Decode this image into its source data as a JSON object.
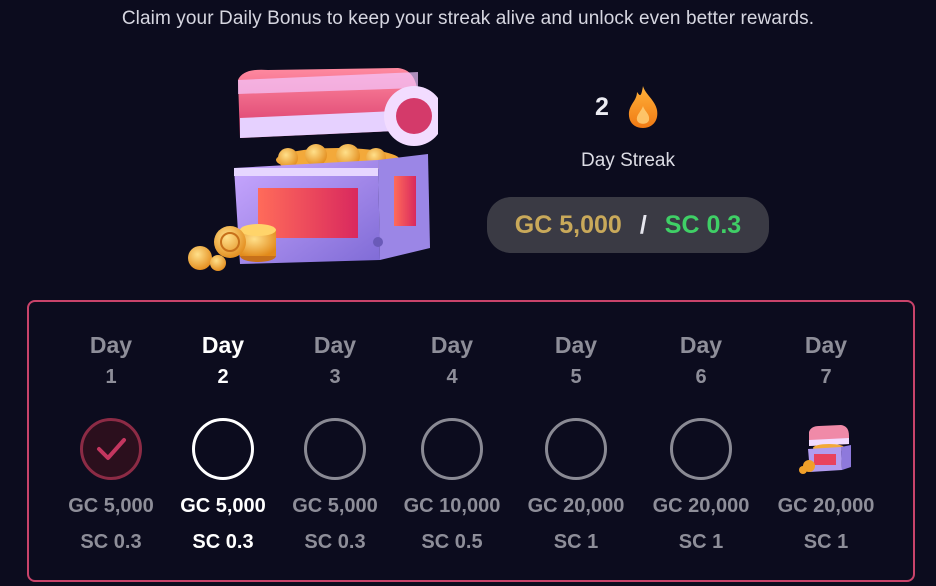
{
  "header": {
    "subtitle": "Claim your Daily Bonus to keep your streak alive and unlock even better rewards."
  },
  "hero": {
    "image": "treasure-chest-icon"
  },
  "streak": {
    "count": "2",
    "icon": "flame-icon",
    "label": "Day Streak"
  },
  "reward": {
    "gc": "GC 5,000",
    "separator": "/",
    "sc": "SC 0.3"
  },
  "days": [
    {
      "label": "Day",
      "number": "1",
      "gc": "GC 5,000",
      "sc": "SC 0.3",
      "status": "claimed"
    },
    {
      "label": "Day",
      "number": "2",
      "gc": "GC 5,000",
      "sc": "SC 0.3",
      "status": "current"
    },
    {
      "label": "Day",
      "number": "3",
      "gc": "GC 5,000",
      "sc": "SC 0.3",
      "status": "locked"
    },
    {
      "label": "Day",
      "number": "4",
      "gc": "GC 10,000",
      "sc": "SC 0.5",
      "status": "locked"
    },
    {
      "label": "Day",
      "number": "5",
      "gc": "GC 20,000",
      "sc": "SC 1",
      "status": "locked"
    },
    {
      "label": "Day",
      "number": "6",
      "gc": "GC 20,000",
      "sc": "SC 1",
      "status": "locked"
    },
    {
      "label": "Day",
      "number": "7",
      "gc": "GC 20,000",
      "sc": "SC 1",
      "status": "chest"
    }
  ],
  "colors": {
    "background": "#0c0c1e",
    "panel_border": "#c9436a",
    "gc_gold": "#c9a95a",
    "sc_green": "#3fcf66",
    "claimed_ring": "#8c2b45",
    "muted_text": "#8e8e99"
  }
}
